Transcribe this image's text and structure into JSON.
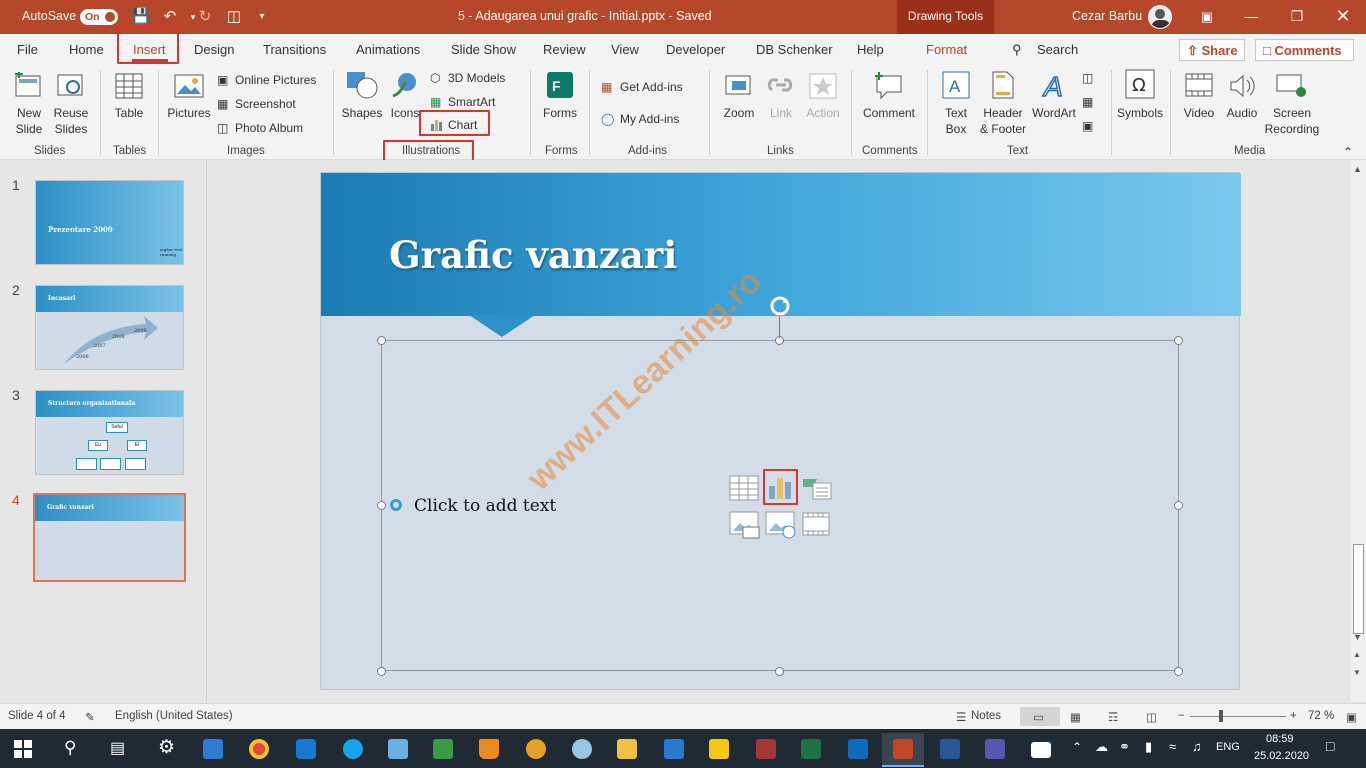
{
  "titlebar": {
    "autosave_label": "AutoSave",
    "autosave_state": "On",
    "document_title": "5 - Adaugarea unui grafic - Initial.pptx  -  Saved",
    "context_label": "Drawing Tools",
    "user_name": "Cezar Barbu"
  },
  "tabs": [
    "File",
    "Home",
    "Insert",
    "Design",
    "Transitions",
    "Animations",
    "Slide Show",
    "Review",
    "View",
    "Developer",
    "DB Schenker",
    "Help",
    "Format"
  ],
  "search_label": "Search",
  "share_label": "Share",
  "comments_label": "Comments",
  "ribbon": {
    "slides": {
      "new_slide": "New\nSlide",
      "reuse_slides": "Reuse\nSlides",
      "group": "Slides"
    },
    "tables": {
      "table": "Table",
      "group": "Tables"
    },
    "images": {
      "pictures": "Pictures",
      "online_pictures": "Online Pictures",
      "screenshot": "Screenshot",
      "photo_album": "Photo Album",
      "group": "Images"
    },
    "illustrations": {
      "shapes": "Shapes",
      "icons": "Icons",
      "models3d": "3D Models",
      "smartart": "SmartArt",
      "chart": "Chart",
      "group": "Illustrations"
    },
    "forms": {
      "forms": "Forms",
      "group": "Forms"
    },
    "addins": {
      "get": "Get Add-ins",
      "my": "My Add-ins",
      "group": "Add-ins"
    },
    "links": {
      "zoom": "Zoom",
      "link": "Link",
      "action": "Action",
      "group": "Links"
    },
    "comments": {
      "comment": "Comment",
      "group": "Comments"
    },
    "text": {
      "textbox": "Text\nBox",
      "header": "Header\n& Footer",
      "wordart": "WordArt",
      "group": "Text"
    },
    "symbols": {
      "symbols": "Symbols"
    },
    "media": {
      "video": "Video",
      "audio": "Audio",
      "screen": "Screen\nRecording",
      "group": "Media"
    }
  },
  "thumbnails": [
    {
      "num": "1",
      "title": "Prezentare 2009",
      "sub": "mgbar test\nrunning"
    },
    {
      "num": "2",
      "title": "Incasari",
      "years": [
        "2006",
        "2007",
        "2008",
        "2009"
      ]
    },
    {
      "num": "3",
      "title": "Structura organizationala",
      "boxes": [
        "Seful",
        "Eu",
        "El"
      ]
    },
    {
      "num": "4",
      "title": "Grafic vanzari"
    }
  ],
  "slide": {
    "title": "Grafic vanzari",
    "placeholder": "Click to add text",
    "watermark": "www.ITLearning.ro"
  },
  "status": {
    "slide_info": "Slide 4 of 4",
    "language": "English (United States)",
    "notes": "Notes",
    "zoom": "72 %"
  },
  "taskbar": {
    "lang": "ENG",
    "time": "08:59",
    "date": "25.02.2020"
  },
  "colors": {
    "accent": "#b7472a",
    "highlight": "#e0322c"
  }
}
